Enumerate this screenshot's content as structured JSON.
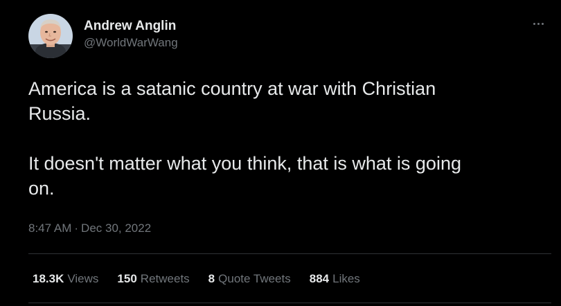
{
  "tweet": {
    "author": {
      "display_name": "Andrew Anglin",
      "handle": "@WorldWarWang"
    },
    "text": "America is a satanic country at war with Christian\nRussia.\n\nIt doesn't matter what you think, that is what is going\non.",
    "time": "8:47 AM",
    "separator": "·",
    "date": "Dec 30, 2022",
    "stats": [
      {
        "value": "18.3K",
        "label": "Views"
      },
      {
        "value": "150",
        "label": "Retweets"
      },
      {
        "value": "8",
        "label": "Quote Tweets"
      },
      {
        "value": "884",
        "label": "Likes"
      }
    ]
  },
  "icons": {
    "more": "more-horizontal-icon"
  },
  "colors": {
    "background": "#000000",
    "primary_text": "#e7e9ea",
    "secondary_text": "#71767b",
    "divider": "#2f3336"
  }
}
